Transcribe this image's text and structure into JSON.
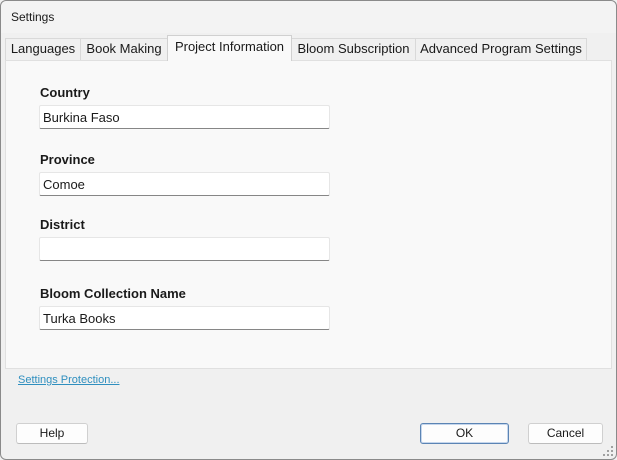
{
  "window": {
    "title": "Settings"
  },
  "tabs": [
    {
      "label": "Languages",
      "active": false
    },
    {
      "label": "Book Making",
      "active": false
    },
    {
      "label": "Project Information",
      "active": true
    },
    {
      "label": "Bloom Subscription",
      "active": false
    },
    {
      "label": "Advanced Program Settings",
      "active": false
    }
  ],
  "fields": {
    "country": {
      "label": "Country",
      "value": "Burkina Faso"
    },
    "province": {
      "label": "Province",
      "value": "Comoe"
    },
    "district": {
      "label": "District",
      "value": ""
    },
    "collection_name": {
      "label": "Bloom Collection Name",
      "value": "Turka Books"
    }
  },
  "links": {
    "settings_protection": "Settings Protection..."
  },
  "buttons": {
    "help": "Help",
    "ok": "OK",
    "cancel": "Cancel"
  },
  "colors": {
    "link": "#2f8fbf",
    "default_button_border": "#5b84b4",
    "panel": "#f9f9f9",
    "window": "#f0f0f0"
  },
  "icons": {
    "resize_grip": "resize-grip-icon"
  }
}
